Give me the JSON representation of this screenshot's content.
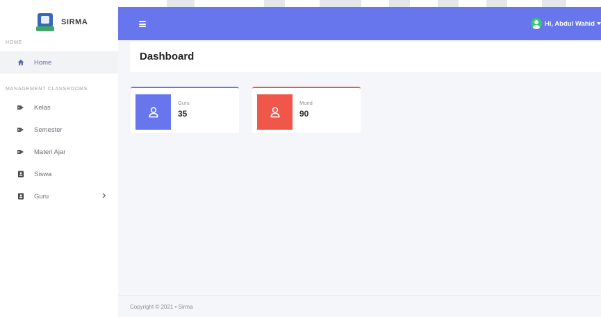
{
  "brand": {
    "name": "SIRMA"
  },
  "sidebar": {
    "sections": [
      {
        "heading": "HOME"
      },
      {
        "heading": "MANAGEMENT CLASSROOMS"
      }
    ],
    "items": [
      {
        "label": "Home",
        "icon": "home-icon"
      },
      {
        "label": "Kelas",
        "icon": "tags-icon"
      },
      {
        "label": "Semester",
        "icon": "tags-icon"
      },
      {
        "label": "Materi Ajar",
        "icon": "tags-icon"
      },
      {
        "label": "Siswa",
        "icon": "id-card-icon"
      },
      {
        "label": "Guru",
        "icon": "id-card-icon"
      }
    ]
  },
  "header": {
    "user_greeting": "Hi, Abdul Wahid"
  },
  "main": {
    "title": "Dashboard",
    "stats": [
      {
        "label": "Guru",
        "value": "35",
        "color": "#6776ec"
      },
      {
        "label": "Murid",
        "value": "90",
        "color": "#f0574a"
      }
    ]
  },
  "footer": {
    "text": "Copyright © 2021 • Sirma"
  },
  "colors": {
    "primary": "#6776ec",
    "danger": "#f0574a",
    "background": "#f4f6f9"
  }
}
